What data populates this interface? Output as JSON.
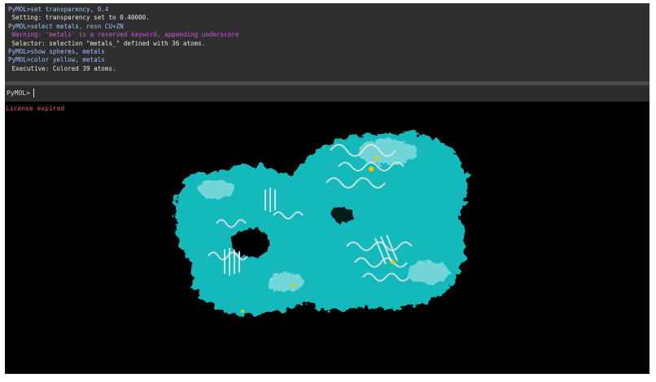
{
  "log": [
    {
      "kind": "cmd",
      "text": "PyMOL>set transparency, 0.4"
    },
    {
      "kind": "out",
      "text": " Setting: transparency set to 0.40000."
    },
    {
      "kind": "cmd",
      "text": "PyMOL>select metals, resn CU+ZN"
    },
    {
      "kind": "warn",
      "text": " Warning: 'metals' is a reserved keyword, appending underscore"
    },
    {
      "kind": "out",
      "text": " Selector: selection \"metals_\" defined with 36 atoms."
    },
    {
      "kind": "cmd",
      "text": "PyMOL>show spheres, metals"
    },
    {
      "kind": "cmd",
      "text": "PyMOL>color yellow, metals"
    },
    {
      "kind": "out",
      "text": " Executive: Colored 39 atoms."
    }
  ],
  "command_line": {
    "prompt": "PyMOL>",
    "value": ""
  },
  "viewport": {
    "license_message": "License expired"
  },
  "colors": {
    "surface": "#19c3c6",
    "cartoon": "#e6e6e6",
    "metal_spheres": "#f2c400",
    "background": "#000000",
    "log_background": "#2e2e2e"
  }
}
